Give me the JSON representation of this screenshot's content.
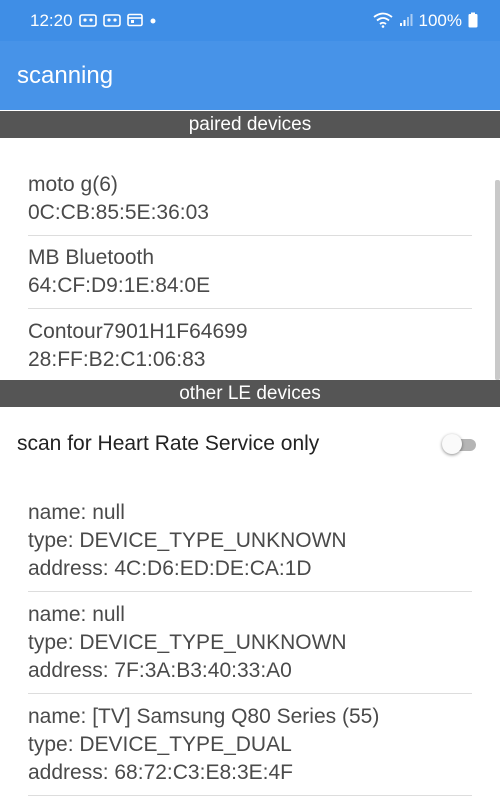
{
  "status_bar": {
    "time": "12:20",
    "battery": "100%",
    "icons": [
      "notification-icon",
      "notification-icon",
      "calendar-icon",
      "dot-icon",
      "wifi-icon",
      "signal-icon",
      "battery-icon"
    ]
  },
  "app_bar": {
    "title": "scanning"
  },
  "paired": {
    "header": "paired devices",
    "items": [
      {
        "name": "moto g(6)",
        "address": "0C:CB:85:5E:36:03"
      },
      {
        "name": "MB Bluetooth",
        "address": "64:CF:D9:1E:84:0E"
      },
      {
        "name": "Contour7901H1F64699",
        "address": "28:FF:B2:C1:06:83"
      }
    ]
  },
  "le": {
    "header": "other LE devices",
    "filter_label": "scan for Heart Rate Service only",
    "filter_enabled": false,
    "items": [
      {
        "name": "name: null",
        "type": "type: DEVICE_TYPE_UNKNOWN",
        "address": "address: 4C:D6:ED:DE:CA:1D"
      },
      {
        "name": "name: null",
        "type": "type: DEVICE_TYPE_UNKNOWN",
        "address": "address: 7F:3A:B3:40:33:A0"
      },
      {
        "name": "name: [TV] Samsung Q80 Series (55)",
        "type": "type: DEVICE_TYPE_DUAL",
        "address": "address: 68:72:C3:E8:3E:4F"
      }
    ]
  },
  "colors": {
    "status_bar": "#3f8ee6",
    "app_bar": "#4793e8",
    "section_header": "#555555"
  }
}
